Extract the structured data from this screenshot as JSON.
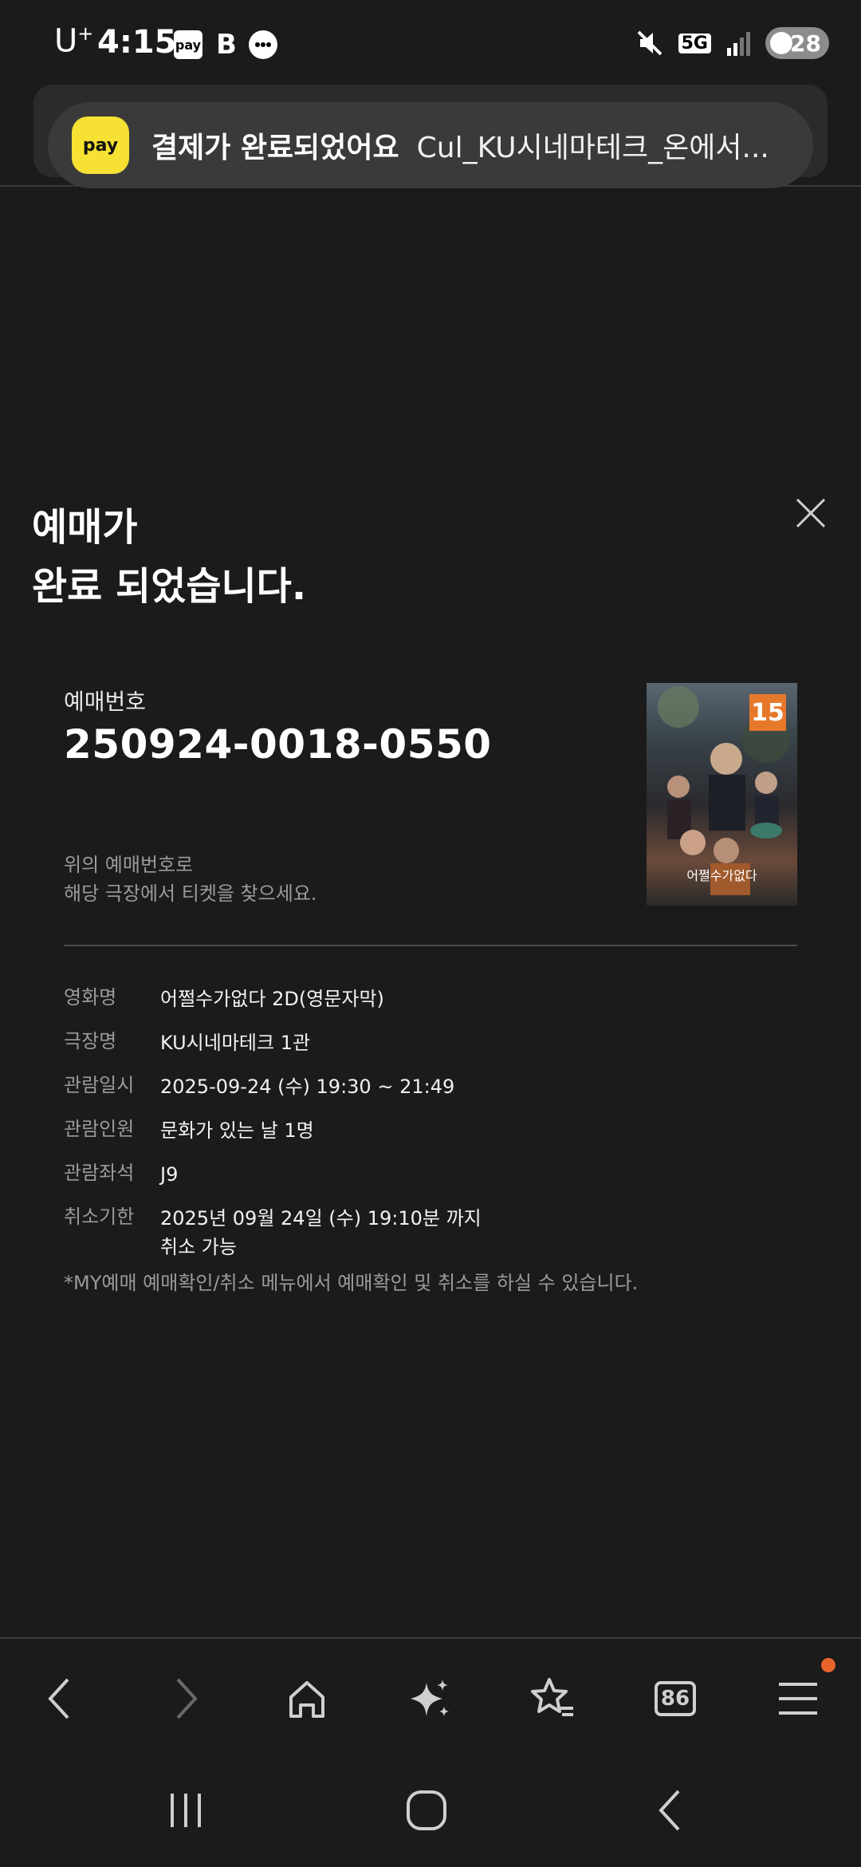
{
  "status_bar": {
    "carrier": "U",
    "carrier_sup": "+",
    "time": "4:15",
    "app_icons": [
      "pay",
      "B",
      "chat-bubble-icon"
    ],
    "network": "5G",
    "battery": "28"
  },
  "notification": {
    "title": "결제가 완료되었어요",
    "body": "Cul_KU시네마테크_온에서...",
    "badge_text": "pay"
  },
  "headline": {
    "line1": "예매가",
    "line2": "완료 되었습니다."
  },
  "ticket": {
    "label": "예매번호",
    "number": "250924-0018-0550",
    "hint_line1": "위의 예매번호로",
    "hint_line2": "해당 극장에서 티켓을 찾으세요."
  },
  "poster": {
    "rating": "15",
    "title": "어쩔수가없다"
  },
  "details": [
    {
      "key": "영화명",
      "value": "어쩔수가없다 2D(영문자막)"
    },
    {
      "key": "극장명",
      "value": "KU시네마테크 1관"
    },
    {
      "key": "관람일시",
      "value": "2025-09-24 (수) 19:30 ~ 21:49"
    },
    {
      "key": "관람인원",
      "value": "문화가 있는 날 1명"
    },
    {
      "key": "관람좌석",
      "value": "J9"
    },
    {
      "key": "취소기한",
      "value": "2025년 09월 24일 (수) 19:10분 까지",
      "value2": "취소 가능"
    }
  ],
  "footnote": "*MY예매 예매확인/취소 메뉴에서 예매확인 및 취소를 하실 수 있습니다.",
  "browser_toolbar": {
    "tab_count": "86"
  },
  "colors": {
    "background": "#1b1b1b",
    "kakao_yellow": "#f7e133",
    "notification_dot": "#e8642c",
    "rating_orange": "#e6782a"
  }
}
